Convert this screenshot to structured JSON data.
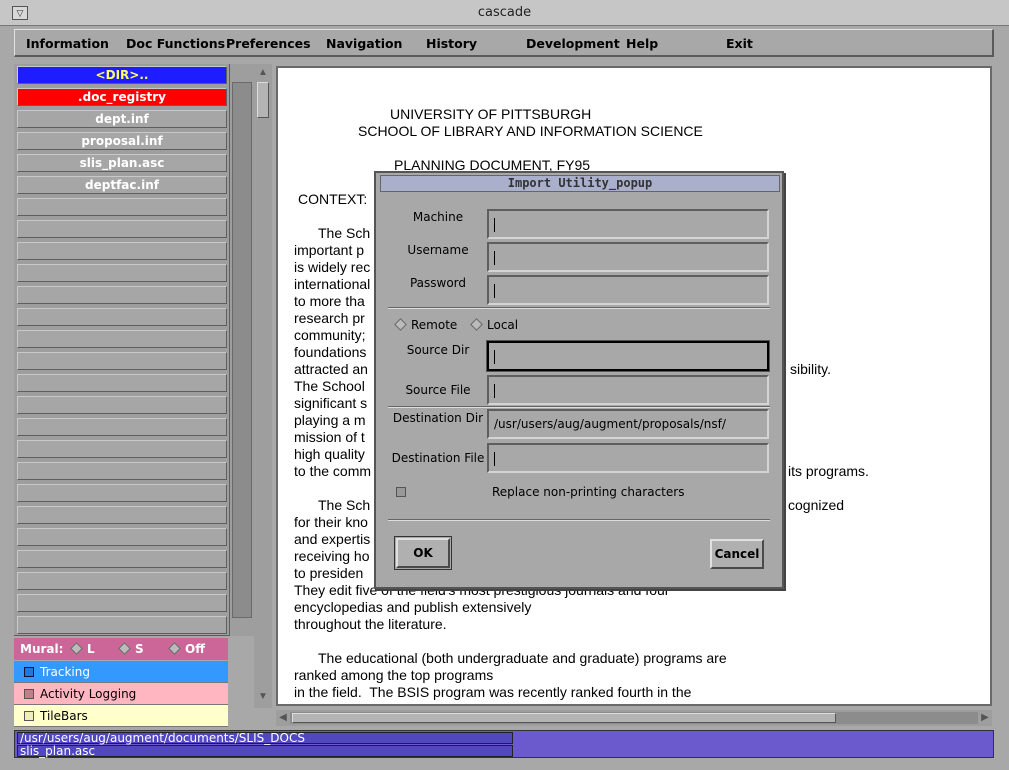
{
  "window": {
    "title": "cascade"
  },
  "menu": [
    "Information",
    "Doc Functions",
    "Preferences",
    "Navigation",
    "History",
    "Development",
    "Help",
    "Exit"
  ],
  "files": [
    "<DIR>..",
    ".doc_registry",
    "dept.inf",
    "proposal.inf",
    "slis_plan.asc",
    "deptfac.inf"
  ],
  "mural": {
    "label": "Mural:",
    "options": [
      "L",
      "S",
      "Off"
    ]
  },
  "options": [
    {
      "label": "Tracking",
      "color": "#3399ff"
    },
    {
      "label": "Activity Logging",
      "color": "#ffb6c1"
    },
    {
      "label": "TileBars",
      "color": "#ffffcc"
    }
  ],
  "document": {
    "lines": [
      "UNIVERSITY OF PITTSBURGH",
      "SCHOOL OF LIBRARY AND INFORMATION SCIENCE",
      "PLANNING DOCUMENT, FY95",
      "CONTEXT:",
      "The Sch",
      "important p",
      "is widely rec",
      "international",
      "to more tha",
      "research pr",
      "community;",
      "foundations",
      "attracted an",
      "The School",
      "significant s",
      "playing a m",
      "mission of t",
      "high quality",
      "to the comm",
      "The Sch",
      "for their kno",
      "and expertis",
      "receiving ho",
      "to presiden",
      "They edit five of the field's most prestigious journals and four",
      "encyclopedias and publish extensively",
      "throughout the literature.",
      "The educational (both undergraduate and graduate) programs are",
      "ranked among the top programs",
      "in the field.  The BSIS program was recently ranked fourth in the"
    ],
    "right_fragments": [
      "sibility.",
      "its programs.",
      "cognized"
    ]
  },
  "popup": {
    "title": "Import Utility_popup",
    "machine_label": "Machine",
    "username_label": "Username",
    "password_label": "Password",
    "remote_label": "Remote",
    "local_label": "Local",
    "source_dir_label": "Source Dir",
    "source_file_label": "Source File",
    "dest_dir_label": "Destination Dir",
    "dest_dir_value": "/usr/users/aug/augment/proposals/nsf/",
    "dest_file_label": "Destination File",
    "replace_label": "Replace non-printing characters",
    "ok_label": "OK",
    "cancel_label": "Cancel"
  },
  "status": {
    "path": "/usr/users/aug/augment/documents/SLIS_DOCS",
    "file": "slis_plan.asc"
  }
}
